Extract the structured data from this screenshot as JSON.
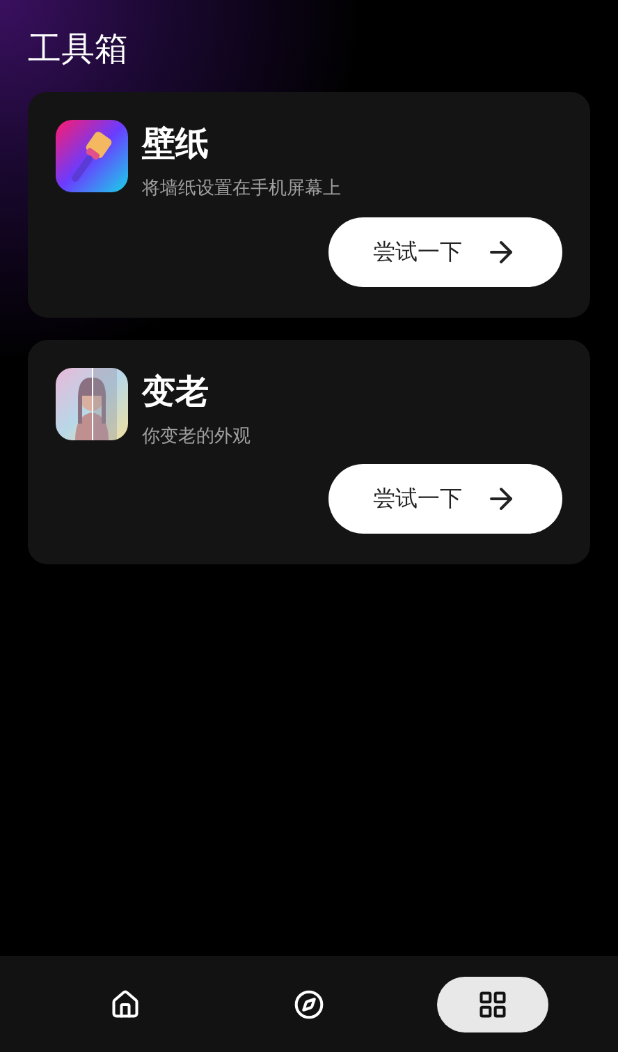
{
  "header": {
    "title": "工具箱"
  },
  "tools": [
    {
      "kind": "brush",
      "title": "壁纸",
      "description": "将墙纸设置在手机屏幕上",
      "button": "尝试一下"
    },
    {
      "kind": "picture",
      "title": "变老",
      "description": "你变老的外观",
      "button": "尝试一下"
    }
  ],
  "nav": [
    {
      "kind": "home",
      "selected": false
    },
    {
      "kind": "compass",
      "selected": false
    },
    {
      "kind": "toolbox",
      "selected": true
    }
  ]
}
